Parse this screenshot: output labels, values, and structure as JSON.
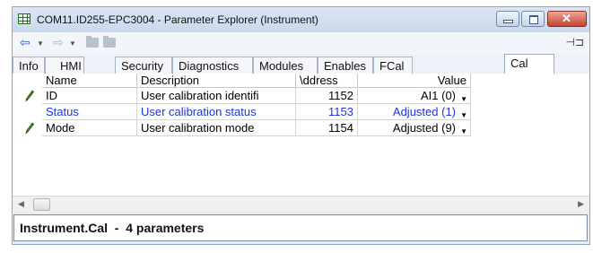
{
  "window": {
    "title": "COM11.ID255-EPC3004 - Parameter Explorer (Instrument)"
  },
  "toolbar": {
    "back_icon": "back-arrow-icon",
    "forward_icon": "forward-arrow-icon",
    "pin_icon": "pin-icon"
  },
  "tabs": [
    {
      "label": "Info"
    },
    {
      "label": "HMI"
    },
    {
      "label": "Security"
    },
    {
      "label": "Diagnostics"
    },
    {
      "label": "Modules"
    },
    {
      "label": "Enables"
    },
    {
      "label": "FCal"
    },
    {
      "label": "Cal"
    }
  ],
  "active_tab": "Cal",
  "table": {
    "columns": [
      "Name",
      "Description",
      "\\ddress",
      "Value"
    ],
    "rows": [
      {
        "name": "ID",
        "description": "User calibration identifi",
        "address": "1152",
        "value": "AI1 (0)",
        "editable": true,
        "color": "#000000"
      },
      {
        "name": "Status",
        "description": "User calibration status",
        "address": "1153",
        "value": "Adjusted (1)",
        "editable": false,
        "color": "#1a36e0"
      },
      {
        "name": "Mode",
        "description": "User calibration mode",
        "address": "1154",
        "value": "Adjusted (9)",
        "editable": true,
        "color": "#000000"
      }
    ]
  },
  "status_bar": {
    "text": "Instrument.Cal  -  4 parameters"
  }
}
